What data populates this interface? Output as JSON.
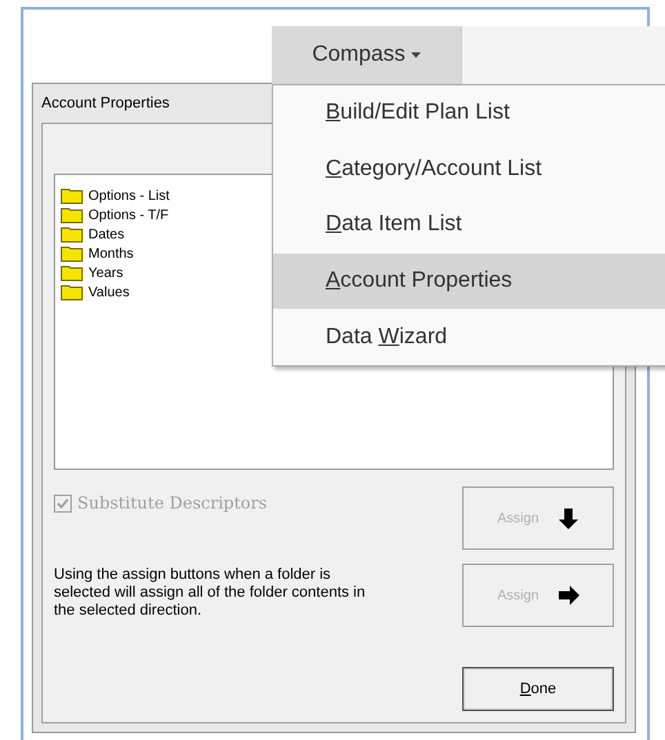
{
  "menu_bar": {
    "menu": {
      "label": "Compass",
      "expanded": true
    }
  },
  "menu": {
    "items": [
      {
        "key": "B",
        "suffix": "uild/Edit Plan List",
        "selected": false
      },
      {
        "key": "C",
        "suffix": "ategory/Account List",
        "selected": false
      },
      {
        "key": "D",
        "suffix": "ata Item List",
        "selected": false
      },
      {
        "key": "A",
        "suffix": "ccount Properties",
        "selected": true
      },
      {
        "prefix": "Data ",
        "key": "W",
        "suffix": "izard",
        "selected": false
      }
    ]
  },
  "dialog": {
    "title": "Account Properties",
    "tree": [
      {
        "label": "Options - List"
      },
      {
        "label": "Options - T/F"
      },
      {
        "label": "Dates"
      },
      {
        "label": "Months"
      },
      {
        "label": "Years"
      },
      {
        "label": "Values"
      }
    ],
    "substitute_descriptors": {
      "label": "Substitute Descriptors",
      "checked": true,
      "disabled": true
    },
    "assign_buttons": [
      {
        "label": "Assign",
        "kind": "down",
        "disabled": true
      },
      {
        "label": "Assign",
        "kind": "right",
        "disabled": true
      }
    ],
    "help_text": "Using the assign buttons when a folder is selected will assign all of the folder contents in the selected direction.",
    "done_button": {
      "key": "D",
      "suffix": "one"
    }
  }
}
